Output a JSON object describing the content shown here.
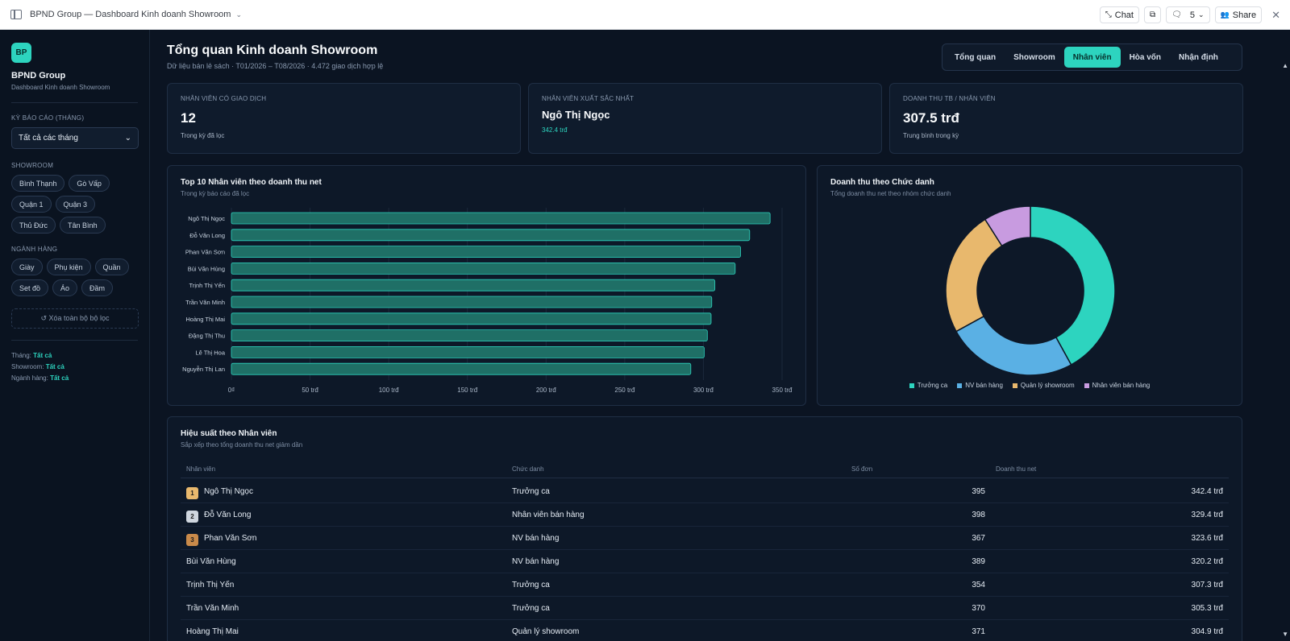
{
  "window": {
    "title": "BPND Group — Dashboard Kinh doanh Showroom",
    "chat_label": "Chat",
    "count": "5",
    "share_label": "Share"
  },
  "sidebar": {
    "logo": "BP",
    "brand": "BPND Group",
    "brand_sub": "Dashboard Kinh doanh Showroom",
    "period_label": "KỲ BÁO CÁO (THÁNG)",
    "period_value": "Tất cả các tháng",
    "showroom_label": "SHOWROOM",
    "showrooms": [
      "Bình Thạnh",
      "Gò Vấp",
      "Quận 1",
      "Quận 3",
      "Thủ Đức",
      "Tân Bình"
    ],
    "category_label": "NGÀNH HÀNG",
    "categories": [
      "Giày",
      "Phụ kiện",
      "Quần",
      "Set đồ",
      "Áo",
      "Đầm"
    ],
    "reset_label": "↺ Xóa toàn bộ bộ lọc",
    "summary": [
      {
        "label": "Tháng:",
        "value": "Tất cả"
      },
      {
        "label": "Showroom:",
        "value": "Tất cả"
      },
      {
        "label": "Ngành hàng:",
        "value": "Tất cả"
      }
    ]
  },
  "header": {
    "title": "Tổng quan Kinh doanh Showroom",
    "subtitle": "Dữ liệu bán lẻ sách · T01/2026 – T08/2026 · 4.472 giao dịch hợp lệ",
    "tabs": [
      "Tổng quan",
      "Showroom",
      "Nhân viên",
      "Hòa vốn",
      "Nhận định"
    ],
    "active_tab": "Nhân viên"
  },
  "kpis": [
    {
      "label": "NHÂN VIÊN CÓ GIAO DỊCH",
      "value": "12",
      "note": "Trong kỳ đã lọc"
    },
    {
      "label": "NHÂN VIÊN XUẤT SẮC NHẤT",
      "value": "Ngô Thị Ngọc",
      "note": "342.4 trđ"
    },
    {
      "label": "DOANH THU TB / NHÂN VIÊN",
      "value": "307.5 trđ",
      "note": "Trung bình trong kỳ"
    }
  ],
  "bar_card": {
    "title": "Top 10 Nhân viên theo doanh thu net",
    "subtitle": "Trong kỳ báo cáo đã lọc"
  },
  "donut_card": {
    "title": "Doanh thu theo Chức danh",
    "subtitle": "Tổng doanh thu net theo nhóm chức danh"
  },
  "chart_data": [
    {
      "type": "bar",
      "orientation": "horizontal",
      "categories": [
        "Ngô Thị Ngọc",
        "Đỗ Văn Long",
        "Phan Văn Sơn",
        "Bùi Văn Hùng",
        "Trịnh Thị Yến",
        "Trần Văn Minh",
        "Hoàng Thị Mai",
        "Đặng Thị Thu",
        "Lê Thị Hoa",
        "Nguyễn Thị Lan"
      ],
      "values": [
        342.4,
        329.4,
        323.6,
        320.2,
        307.3,
        305.3,
        304.9,
        302.5,
        300.5,
        292.0
      ],
      "xticks": [
        "0₫",
        "50 trđ",
        "100 trđ",
        "150 trđ",
        "200 trđ",
        "250 trđ",
        "300 trđ",
        "350 trđ"
      ],
      "xlim": [
        0,
        350
      ],
      "color": "#1f6f66",
      "edge": "#2dd4bf"
    },
    {
      "type": "pie",
      "donut": true,
      "labels": [
        "Trưởng ca",
        "NV bán hàng",
        "Quản lý showroom",
        "Nhân viên bán hàng"
      ],
      "values": [
        42,
        25,
        24,
        9
      ],
      "colors": [
        "#2dd4bf",
        "#5ab0e4",
        "#e8b86d",
        "#c89be0"
      ]
    }
  ],
  "table": {
    "title": "Hiệu suất theo Nhân viên",
    "subtitle": "Sắp xếp theo tổng doanh thu net giảm dần",
    "columns": [
      "Nhân viên",
      "Chức danh",
      "Số đơn",
      "Doanh thu net"
    ],
    "rows": [
      {
        "rank": "1",
        "name": "Ngô Thị Ngọc",
        "role": "Trưởng ca",
        "orders": "395",
        "revenue": "342.4 trđ"
      },
      {
        "rank": "2",
        "name": "Đỗ Văn Long",
        "role": "Nhân viên bán hàng",
        "orders": "398",
        "revenue": "329.4 trđ"
      },
      {
        "rank": "3",
        "name": "Phan Văn Sơn",
        "role": "NV bán hàng",
        "orders": "367",
        "revenue": "323.6 trđ"
      },
      {
        "rank": "",
        "name": "Bùi Văn Hùng",
        "role": "NV bán hàng",
        "orders": "389",
        "revenue": "320.2 trđ"
      },
      {
        "rank": "",
        "name": "Trịnh Thị Yến",
        "role": "Trưởng ca",
        "orders": "354",
        "revenue": "307.3 trđ"
      },
      {
        "rank": "",
        "name": "Trần Văn Minh",
        "role": "Trưởng ca",
        "orders": "370",
        "revenue": "305.3 trđ"
      },
      {
        "rank": "",
        "name": "Hoàng Thị Mai",
        "role": "Quản lý showroom",
        "orders": "371",
        "revenue": "304.9 trđ"
      }
    ],
    "rank_colors": [
      "#e8b86d",
      "#cfd6df",
      "#c98a4a"
    ]
  }
}
